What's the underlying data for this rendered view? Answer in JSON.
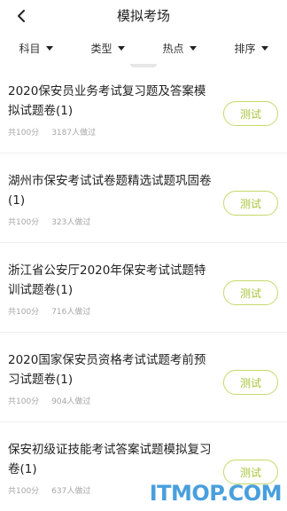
{
  "header": {
    "title": "模拟考场",
    "back_icon": "chevron-left-icon"
  },
  "filters": [
    {
      "label": "科目",
      "icon": "caret-down-icon"
    },
    {
      "label": "类型",
      "icon": "caret-down-icon"
    },
    {
      "label": "热点",
      "icon": "caret-down-icon"
    },
    {
      "label": "排序",
      "icon": "caret-down-icon"
    }
  ],
  "items": [
    {
      "title": "2020保安员业务考试复习题及答案模拟试题卷(1)",
      "total": "共100分",
      "count": "3187人做过",
      "button": "测试"
    },
    {
      "title": "湖州市保安考试试卷题精选试题巩固卷(1)",
      "total": "共100分",
      "count": "323人做过",
      "button": "测试"
    },
    {
      "title": "浙江省公安厅2020年保安考试试题特训试题卷(1)",
      "total": "共100分",
      "count": "716人做过",
      "button": "测试"
    },
    {
      "title": "2020国家保安员资格考试试题考前预习试题卷(1)",
      "total": "共100分",
      "count": "904人做过",
      "button": "测试"
    },
    {
      "title": "保安初级证技能考试答案试题模拟复习卷(1)",
      "total": "共100分",
      "count": "637人做过",
      "button": "测试"
    }
  ],
  "colors": {
    "accent_border": "#c6d96a",
    "accent_text": "#a8c43a",
    "meta_text": "#a6a6a6"
  },
  "watermark": "ITMOP.COM"
}
